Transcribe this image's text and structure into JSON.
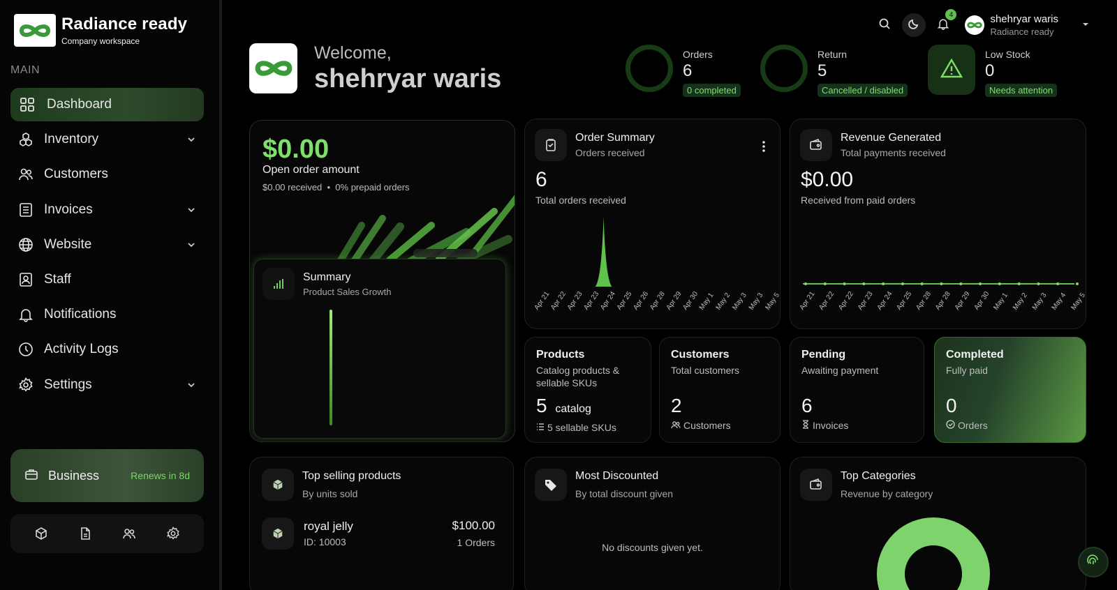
{
  "brand": {
    "title": "Radiance ready",
    "subtitle": "Company workspace"
  },
  "sidebar": {
    "section_label": "MAIN",
    "items": [
      {
        "label": "Dashboard",
        "icon": "grid-icon",
        "active": true,
        "has_submenu": false
      },
      {
        "label": "Inventory",
        "icon": "cubes-icon",
        "has_submenu": true
      },
      {
        "label": "Customers",
        "icon": "users-icon",
        "has_submenu": false
      },
      {
        "label": "Invoices",
        "icon": "invoice-list-icon",
        "has_submenu": true
      },
      {
        "label": "Website",
        "icon": "globe-icon",
        "has_submenu": true
      },
      {
        "label": "Staff",
        "icon": "id-badge-icon",
        "has_submenu": false
      },
      {
        "label": "Notifications",
        "icon": "bell-icon",
        "has_submenu": false
      },
      {
        "label": "Activity Logs",
        "icon": "clock-icon",
        "has_submenu": false
      },
      {
        "label": "Settings",
        "icon": "gear-icon",
        "has_submenu": true
      }
    ],
    "plan": {
      "name": "Business",
      "renew": "Renews in 8d"
    },
    "quick_actions": [
      "box-icon",
      "document-icon",
      "users-icon",
      "gear-icon"
    ]
  },
  "topbar": {
    "notification_count": "4",
    "user": {
      "name": "shehryar waris",
      "role": "Radiance ready"
    }
  },
  "welcome": {
    "greeting": "Welcome,",
    "name": "shehryar waris"
  },
  "stats": {
    "orders": {
      "label": "Orders",
      "value": "6",
      "pill": "0 completed"
    },
    "return": {
      "label": "Return",
      "value": "5",
      "pill": "Cancelled / disabled"
    },
    "low_stock": {
      "label": "Low Stock",
      "value": "0",
      "pill": "Needs attention"
    }
  },
  "open_order": {
    "amount": "$0.00",
    "label": "Open order amount",
    "received": "$0.00 received",
    "prepaid": "0% prepaid orders",
    "summary": {
      "title": "Summary",
      "subtitle": "Product Sales Growth"
    }
  },
  "order_summary": {
    "title": "Order Summary",
    "subtitle": "Orders received",
    "total": "6",
    "caption": "Total orders received",
    "dates": [
      "Apr 21",
      "Apr 22",
      "Apr 23",
      "Apr 23",
      "Apr 24",
      "Apr 25",
      "Apr 26",
      "Apr 28",
      "Apr 29",
      "Apr 30",
      "May 1",
      "May 2",
      "May 3",
      "May 3",
      "May 5"
    ],
    "values": [
      0,
      0,
      0,
      0,
      6,
      0,
      0,
      0,
      0,
      0,
      0,
      0,
      0,
      0,
      0
    ]
  },
  "revenue": {
    "title": "Revenue Generated",
    "subtitle": "Total payments received",
    "total": "$0.00",
    "caption": "Received from paid orders",
    "dates": [
      "Apr 21",
      "Apr 22",
      "Apr 22",
      "Apr 23",
      "Apr 24",
      "Apr 25",
      "Apr 28",
      "Apr 28",
      "Apr 29",
      "Apr 30",
      "May 1",
      "May 2",
      "May 3",
      "May 4",
      "May 5"
    ],
    "values": [
      0,
      0,
      0,
      0,
      0,
      0,
      0,
      0,
      0,
      0,
      0,
      0,
      0,
      0,
      0
    ]
  },
  "cards": {
    "products": {
      "title": "Products",
      "subtitle": "Catalog products & sellable SKUs",
      "value": "5",
      "unit": "catalog",
      "footer": "5 sellable SKUs"
    },
    "customers": {
      "title": "Customers",
      "subtitle": "Total customers",
      "value": "2",
      "footer": "Customers"
    },
    "pending": {
      "title": "Pending",
      "subtitle": "Awaiting payment",
      "value": "6",
      "footer": "Invoices"
    },
    "completed": {
      "title": "Completed",
      "subtitle": "Fully paid",
      "value": "0",
      "footer": "Orders"
    }
  },
  "top_selling": {
    "title": "Top selling products",
    "subtitle": "By units sold",
    "items": [
      {
        "name": "royal jelly",
        "id": "ID: 10003",
        "price": "$100.00",
        "orders": "1 Orders"
      }
    ]
  },
  "most_discounted": {
    "title": "Most Discounted",
    "subtitle": "By total discount given",
    "empty": "No discounts given yet."
  },
  "top_categories": {
    "title": "Top Categories",
    "subtitle": "Revenue by category"
  },
  "colors": {
    "accent": "#7ee06a",
    "accent_dark": "#163b15",
    "bg": "#000000",
    "card": "#070707"
  }
}
